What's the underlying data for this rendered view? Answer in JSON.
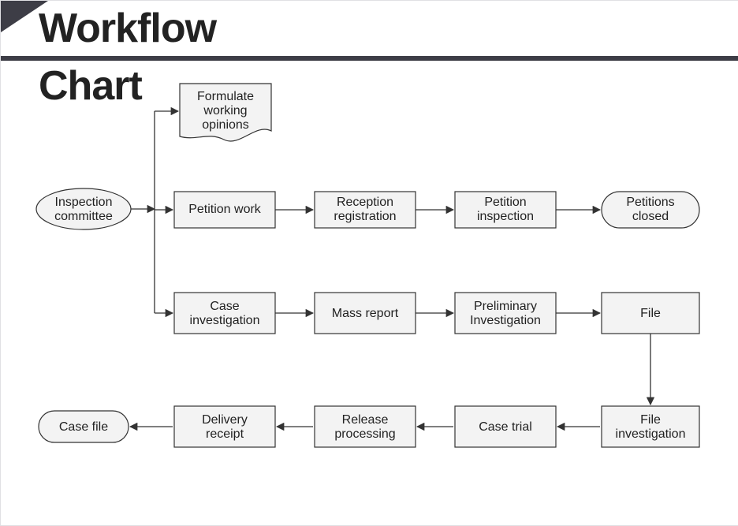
{
  "title_line1": "Workflow",
  "title_line2": "Chart",
  "nodes": {
    "inspection_committee": [
      "Inspection",
      "committee"
    ],
    "formulate": [
      "Formulate",
      "working",
      "opinions"
    ],
    "petition_work": [
      "Petition work"
    ],
    "reception_registration": [
      "Reception",
      "registration"
    ],
    "petition_inspection": [
      "Petition",
      "inspection"
    ],
    "petitions_closed": [
      "Petitions",
      "closed"
    ],
    "case_investigation": [
      "Case",
      "investigation"
    ],
    "mass_report": [
      "Mass report"
    ],
    "preliminary_investigation": [
      "Preliminary",
      "Investigation"
    ],
    "file": [
      "File"
    ],
    "file_investigation": [
      "File",
      "investigation"
    ],
    "case_trial": [
      "Case trial"
    ],
    "release_processing": [
      "Release",
      "processing"
    ],
    "delivery_receipt": [
      "Delivery",
      "receipt"
    ],
    "case_file": [
      "Case file"
    ]
  }
}
